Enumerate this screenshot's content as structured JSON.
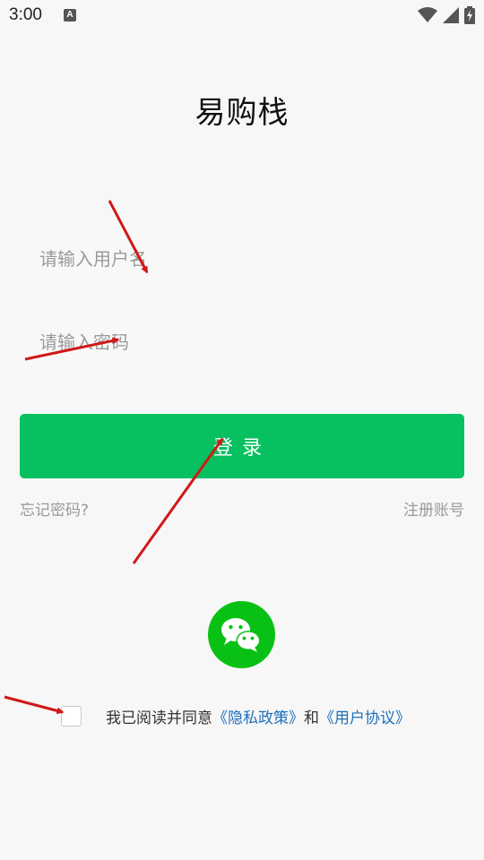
{
  "status_bar": {
    "time": "3:00",
    "a_icon_letter": "A"
  },
  "app_title": "易购栈",
  "form": {
    "username_placeholder": "请输入用户名",
    "password_placeholder": "请输入密码",
    "login_label": "登录"
  },
  "links": {
    "forgot_password": "忘记密码?",
    "register": "注册账号"
  },
  "agreement": {
    "prefix": "我已阅读并同意",
    "privacy_policy": "《隐私政策》",
    "conjunction": "和",
    "user_agreement": "《用户协议》",
    "checked": false
  },
  "colors": {
    "primary_green": "#07c160",
    "wechat_green": "#09c114",
    "link_blue": "#1f6fb8",
    "annotation_red": "#d01818"
  }
}
